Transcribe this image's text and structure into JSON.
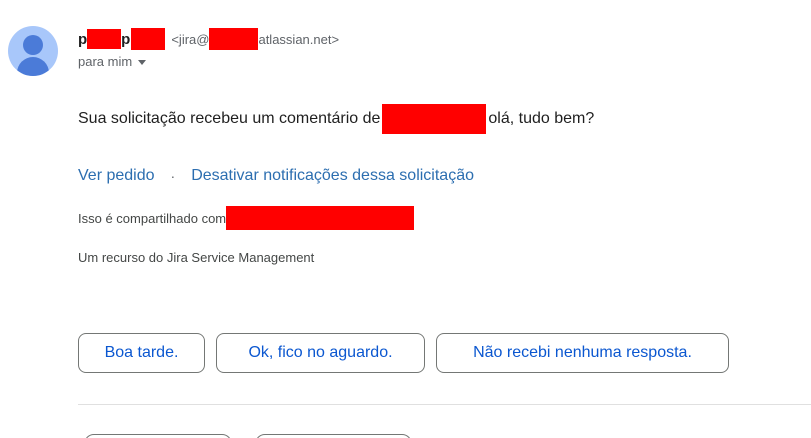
{
  "sender": {
    "name_part1": "p",
    "name_part2": "p",
    "email_prefix": "<jira@",
    "email_suffix": "atlassian.net>",
    "recipient_label": "para mim"
  },
  "message": {
    "text_before": "Sua solicitação recebeu um comentário de",
    "text_after": "olá, tudo bem?"
  },
  "links": {
    "view_request": "Ver pedido",
    "separator": "·",
    "disable_notifications": "Desativar notificações dessa solicitação"
  },
  "shared": {
    "label": "Isso é compartilhado com"
  },
  "footer": {
    "note": "Um recurso do Jira Service Management"
  },
  "smart_replies": [
    "Boa tarde.",
    "Ok, fico no aguardo.",
    "Não recebi nenhuma resposta."
  ],
  "colors": {
    "redaction": "#ff0000",
    "link": "#2c6eb0",
    "chip_text": "#0b57d0",
    "avatar_bg": "#a8c7fa",
    "avatar_fg": "#4b7bd8"
  }
}
